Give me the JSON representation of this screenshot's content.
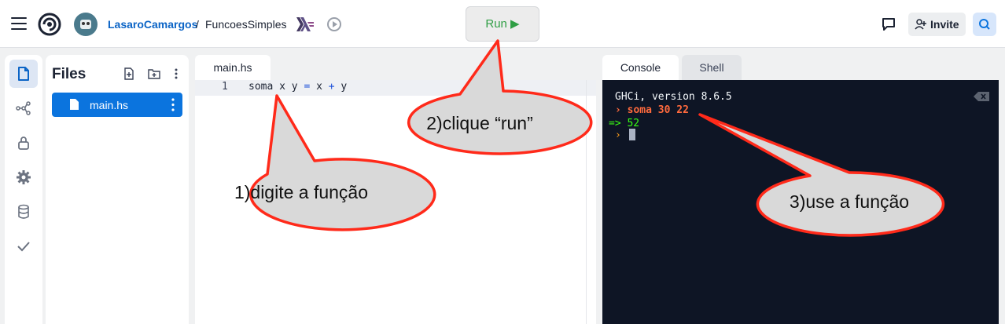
{
  "header": {
    "user": "LasaroCamargos",
    "separator": "/",
    "project": "FuncoesSimples",
    "run_label": "Run ▶",
    "invite_label": "Invite"
  },
  "sidebar": {
    "items": [
      "files-icon",
      "share-icon",
      "lock-icon",
      "settings-icon",
      "database-icon",
      "check-icon"
    ]
  },
  "files": {
    "title": "Files",
    "items": [
      {
        "name": "main.hs"
      }
    ]
  },
  "editor": {
    "tab": "main.hs",
    "line_number": "1",
    "code_tokens": [
      "soma x y ",
      "=",
      " x ",
      "+",
      " y"
    ]
  },
  "console": {
    "tabs": [
      "Console",
      "Shell"
    ],
    "lines": [
      "GHCi, version 8.6.5",
      "› soma 30 22",
      "=> 52",
      "›"
    ]
  },
  "annotations": [
    "1)digite a função",
    "2)clique “run”",
    "3)use a função"
  ],
  "colors": {
    "accent": "#0b74de",
    "run_green": "#2f9e44",
    "terminal_bg": "#0e1525",
    "callout_border": "#ff2a1a",
    "callout_fill": "#d9d9d9"
  }
}
